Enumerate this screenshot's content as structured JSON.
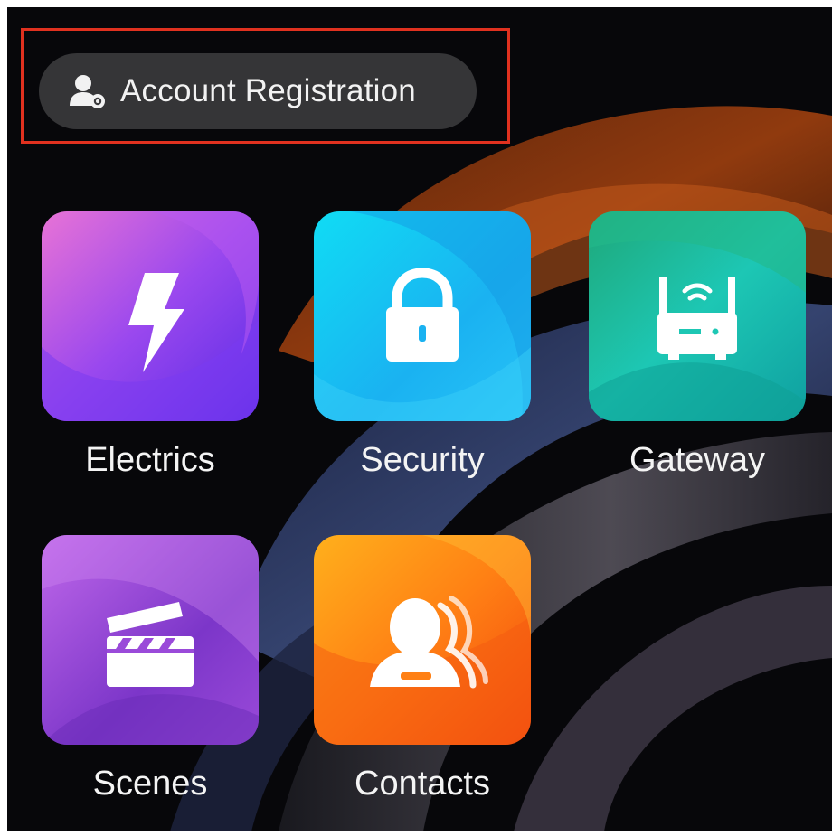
{
  "account": {
    "label": "Account Registration",
    "icon": "user-add-icon"
  },
  "apps": [
    {
      "label": "Electrics",
      "icon": "lightning-bolt-icon",
      "colors": [
        "#e06ad8",
        "#8a43f0",
        "#5b2ee8"
      ]
    },
    {
      "label": "Security",
      "icon": "padlock-icon",
      "colors": [
        "#0bd7f2",
        "#1aa6ef",
        "#20b8f5"
      ]
    },
    {
      "label": "Gateway",
      "icon": "router-icon",
      "colors": [
        "#1fb383",
        "#1bc9b7",
        "#10a7a0"
      ]
    },
    {
      "label": "Scenes",
      "icon": "clapperboard-icon",
      "colors": [
        "#b15be8",
        "#7c36c9",
        "#9a4ad9"
      ]
    },
    {
      "label": "Contacts",
      "icon": "contacts-group-icon",
      "colors": [
        "#ffab1a",
        "#ff7a12",
        "#f4480f"
      ]
    }
  ],
  "colors": {
    "highlight": "#e0311f",
    "chip_background": "#3a3a3c",
    "background": "#07070a"
  }
}
